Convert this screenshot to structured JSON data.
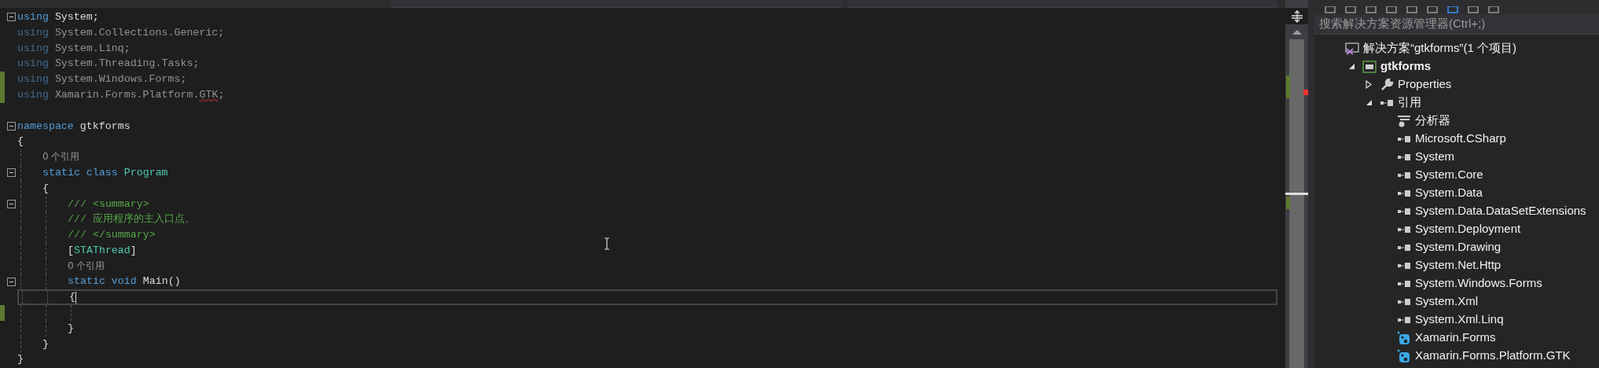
{
  "editor": {
    "lines": [
      {
        "expanded": true,
        "tokens": [
          {
            "kind": "keyword",
            "text": "using"
          },
          {
            "kind": "plain",
            "text": " System;"
          }
        ]
      },
      {
        "unnecessary": true,
        "tokens": [
          {
            "kind": "keyword",
            "text": "using"
          },
          {
            "kind": "plain",
            "text": " System.Collections.Generic;"
          }
        ]
      },
      {
        "unnecessary": true,
        "tokens": [
          {
            "kind": "keyword",
            "text": "using"
          },
          {
            "kind": "plain",
            "text": " System.Linq;"
          }
        ]
      },
      {
        "unnecessary": true,
        "tokens": [
          {
            "kind": "keyword",
            "text": "using"
          },
          {
            "kind": "plain",
            "text": " System.Threading.Tasks;"
          }
        ]
      },
      {
        "unnecessary": true,
        "changed": true,
        "tokens": [
          {
            "kind": "keyword",
            "text": "using"
          },
          {
            "kind": "plain",
            "text": " System.Windows.Forms;"
          }
        ]
      },
      {
        "unnecessary": true,
        "changed": true,
        "tokens": [
          {
            "kind": "keyword",
            "text": "using"
          },
          {
            "kind": "plain",
            "text": " Xamarin.Forms.Platform."
          },
          {
            "kind": "plain",
            "text": "GTK",
            "error": true
          },
          {
            "kind": "plain",
            "text": ";"
          }
        ]
      },
      {
        "blank_above": true,
        "expanded": true,
        "tokens": [
          {
            "kind": "keyword",
            "text": "namespace"
          },
          {
            "kind": "plain",
            "text": " gtkforms"
          }
        ]
      },
      {
        "tokens": [
          {
            "kind": "plain",
            "text": "{"
          }
        ],
        "children": [
          {
            "tokens": [
              {
                "kind": "hint",
                "text": "0 个引用"
              }
            ]
          },
          {
            "expanded": true,
            "tokens": [
              {
                "kind": "keyword",
                "text": "static class "
              },
              {
                "kind": "type",
                "text": "Program"
              }
            ]
          },
          {
            "tokens": [
              {
                "kind": "plain",
                "text": "{"
              }
            ],
            "children": [
              {
                "expanded": true,
                "tokens": [
                  {
                    "kind": "comment",
                    "text": "/// <summary>"
                  }
                ]
              },
              {
                "tokens": [
                  {
                    "kind": "comment",
                    "text": "/// 应用程序的主入口点。"
                  }
                ]
              },
              {
                "tokens": [
                  {
                    "kind": "comment",
                    "text": "/// </summary>"
                  }
                ]
              },
              {
                "tokens": [
                  {
                    "kind": "plain",
                    "text": "["
                  },
                  {
                    "kind": "type",
                    "text": "STAThread"
                  },
                  {
                    "kind": "plain",
                    "text": "]"
                  }
                ]
              },
              {
                "tokens": [
                  {
                    "kind": "hint",
                    "text": "0 个引用"
                  }
                ]
              },
              {
                "expanded": true,
                "tokens": [
                  {
                    "kind": "keyword",
                    "text": "static void"
                  },
                  {
                    "kind": "plain",
                    "text": " Main()"
                  }
                ]
              },
              {
                "current": true,
                "tokens": [
                  {
                    "kind": "plain",
                    "text": "{"
                  }
                ],
                "children": [
                  {
                    "changed": true
                  }
                ]
              },
              {
                "tokens": [
                  {
                    "kind": "plain",
                    "text": "}"
                  }
                ]
              }
            ]
          },
          {
            "tokens": [
              {
                "kind": "plain",
                "text": "}"
              }
            ]
          }
        ]
      },
      {
        "tokens": [
          {
            "kind": "plain",
            "text": "}"
          }
        ]
      }
    ]
  },
  "solution_explorer": {
    "search": {
      "placeholder": "搜索解决方案资源管理器(Ctrl+;)"
    },
    "tree": [
      {
        "kind": "solution",
        "label": "解决方案“gtkforms”(1 个项目)",
        "children": [
          {
            "kind": "project",
            "label": "gtkforms",
            "expanded": true,
            "children": [
              {
                "kind": "properties",
                "label": "Properties",
                "expanded": false
              },
              {
                "kind": "references",
                "label": "引用",
                "expanded": true,
                "children": [
                  {
                    "kind": "analyzers",
                    "label": "分析器"
                  },
                  {
                    "kind": "assembly",
                    "label": "Microsoft.CSharp"
                  },
                  {
                    "kind": "assembly",
                    "label": "System"
                  },
                  {
                    "kind": "assembly",
                    "label": "System.Core"
                  },
                  {
                    "kind": "assembly",
                    "label": "System.Data"
                  },
                  {
                    "kind": "assembly",
                    "label": "System.Data.DataSetExtensions"
                  },
                  {
                    "kind": "assembly",
                    "label": "System.Deployment"
                  },
                  {
                    "kind": "assembly",
                    "label": "System.Drawing"
                  },
                  {
                    "kind": "assembly",
                    "label": "System.Net.Http"
                  },
                  {
                    "kind": "assembly",
                    "label": "System.Windows.Forms"
                  },
                  {
                    "kind": "assembly",
                    "label": "System.Xml"
                  },
                  {
                    "kind": "assembly",
                    "label": "System.Xml.Linq"
                  },
                  {
                    "kind": "package",
                    "label": "Xamarin.Forms"
                  },
                  {
                    "kind": "package",
                    "label": "Xamarin.Forms.Platform.GTK"
                  }
                ]
              }
            ]
          }
        ]
      }
    ]
  }
}
